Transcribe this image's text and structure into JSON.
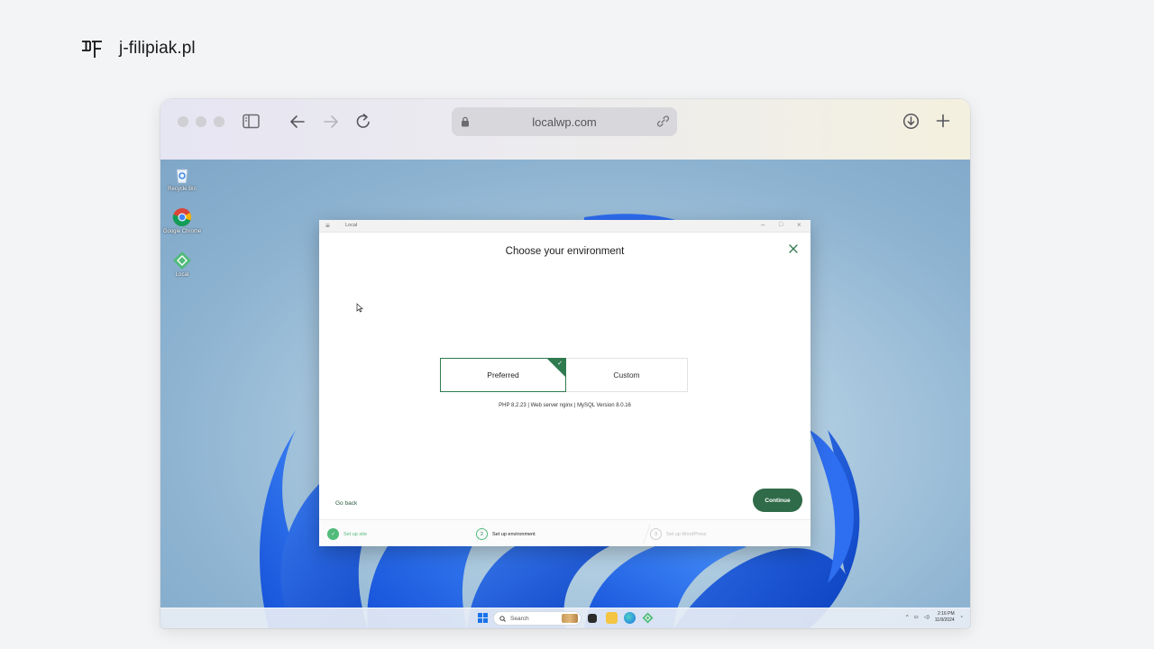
{
  "brand": {
    "name": "j-filipiak.pl"
  },
  "browser": {
    "url": "localwp.com",
    "icons": [
      "sidebar-icon",
      "back-arrow-icon",
      "forward-arrow-icon",
      "reload-icon",
      "lock-icon",
      "link-icon",
      "download-icon",
      "plus-icon"
    ]
  },
  "desktop": {
    "icons": [
      {
        "label": "Recycle Bin",
        "icon": "recycle-bin-icon"
      },
      {
        "label": "Google Chrome",
        "icon": "chrome-icon"
      },
      {
        "label": "Local",
        "icon": "local-app-icon"
      }
    ]
  },
  "local_window": {
    "title": "Local",
    "controls": {
      "minimize": "–",
      "maximize": "□",
      "close": "×"
    },
    "modal_title": "Choose your environment",
    "options": {
      "preferred": "Preferred",
      "custom": "Custom",
      "selected": "Preferred"
    },
    "environment_info": "PHP 8.2.23 | Web server nginx | MySQL Version 8.0.16",
    "go_back": "Go back",
    "continue": "Continue",
    "steps": [
      {
        "number": "1",
        "label": "Set up site",
        "state": "done"
      },
      {
        "number": "2",
        "label": "Set up environment",
        "state": "active"
      },
      {
        "number": "3",
        "label": "Set up WordPress",
        "state": "pending"
      }
    ]
  },
  "taskbar": {
    "search_placeholder": "Search",
    "time": "2:16 PM",
    "date": "11/9/2024"
  },
  "colors": {
    "accent_green": "#2f6b48",
    "selected_border": "#2f7a4f",
    "win11_blue": "#1a73e8"
  }
}
